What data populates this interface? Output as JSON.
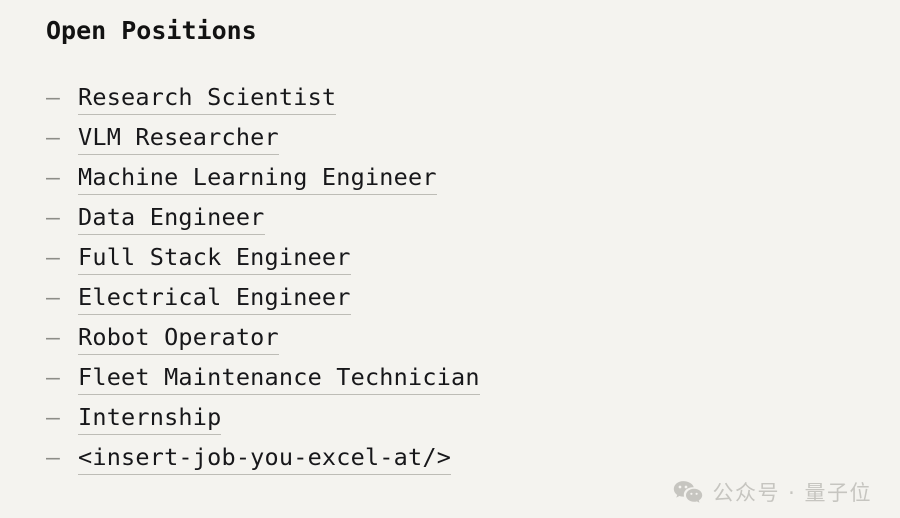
{
  "page": {
    "title": "Open Positions",
    "background_color": "#f4f3ef",
    "text_color": "#17171a",
    "underline_color": "#bdbcb6",
    "bullet_color": "#8d8d88",
    "bullet_glyph": "–"
  },
  "positions": [
    {
      "label": "Research Scientist"
    },
    {
      "label": "VLM Researcher"
    },
    {
      "label": "Machine Learning Engineer"
    },
    {
      "label": "Data Engineer"
    },
    {
      "label": "Full Stack Engineer"
    },
    {
      "label": "Electrical Engineer"
    },
    {
      "label": "Robot Operator"
    },
    {
      "label": "Fleet Maintenance Technician"
    },
    {
      "label": "Internship"
    },
    {
      "label": "<insert-job-you-excel-at/>"
    }
  ],
  "watermark": {
    "icon": "wechat-icon",
    "text": "公众号 · 量子位",
    "color": "#c6c5c0"
  }
}
